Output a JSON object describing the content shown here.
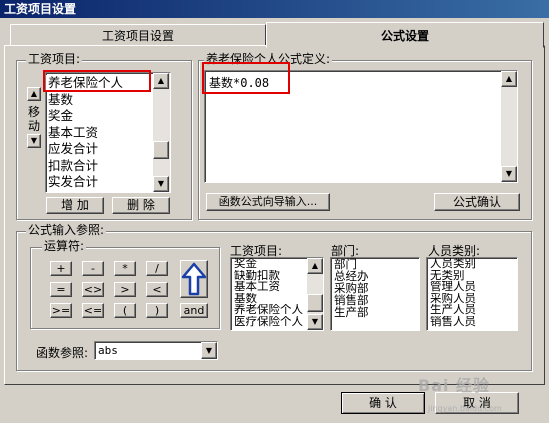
{
  "window": {
    "title": "工资项目设置"
  },
  "tabs": [
    {
      "label": "工资项目设置"
    },
    {
      "label": "公式设置"
    }
  ],
  "salary_items_group": {
    "legend": "工资项目:",
    "move_label": "移动",
    "items": [
      "养老保险个人",
      "基数",
      "奖金",
      "基本工资",
      "应发合计",
      "扣款合计",
      "实发合计"
    ],
    "selected_index": 0,
    "add_label": "增 加",
    "delete_label": "删 除"
  },
  "formula_group": {
    "legend": "养老保险个人公式定义:",
    "formula_text": "基数*0.08",
    "wizard_label": "函数公式向导输入...",
    "confirm_label": "公式确认"
  },
  "input_ref_group": {
    "legend": "公式输入参照:",
    "operators_legend": "运算符:",
    "operators": [
      "+",
      "-",
      "*",
      "/",
      "=",
      "<>",
      ">",
      "<",
      ">=",
      "<=",
      "(",
      ")",
      "and"
    ],
    "items_label": "工资项目:",
    "items": [
      "奖金",
      "缺勤扣款",
      "基本工资",
      "基数",
      "养老保险个人",
      "医疗保险个人"
    ],
    "dept_label": "部门:",
    "depts": [
      "部门",
      "总经办",
      "采购部",
      "销售部",
      "生产部"
    ],
    "category_label": "人员类别:",
    "categories": [
      "人员类别",
      "无类别",
      "管理人员",
      "采购人员",
      "生产人员",
      "销售人员"
    ],
    "func_label": "函数参照:",
    "func_value": "abs"
  },
  "footer": {
    "ok_label": "确 认",
    "cancel_label": "取 消"
  },
  "watermark": {
    "text": "Bai 经验",
    "sub": "jingyan.baidu.com"
  },
  "colors": {
    "titlebar": "#0a246a",
    "highlight": "#e00000",
    "face": "#d4d0c8"
  }
}
